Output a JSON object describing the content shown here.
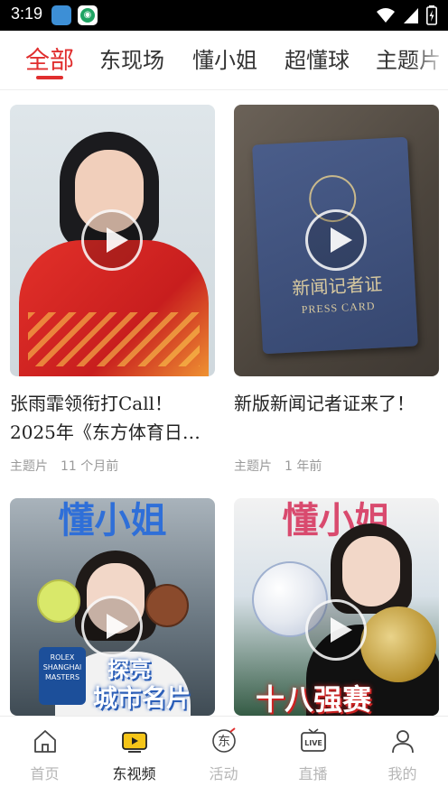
{
  "status_bar": {
    "time": "3:19",
    "icons": [
      "notification-app-icon",
      "app-icon",
      "wifi-icon",
      "signal-icon",
      "battery-icon"
    ]
  },
  "tabs": [
    {
      "label": "全部",
      "active": true
    },
    {
      "label": "东现场",
      "active": false
    },
    {
      "label": "懂小姐",
      "active": false
    },
    {
      "label": "超懂球",
      "active": false
    },
    {
      "label": "主题片",
      "active": false
    }
  ],
  "feed": [
    {
      "title": "张雨霏领衔打Call！2025年《东方体育日…",
      "tag": "主题片",
      "time": "11 个月前",
      "thumb_icon": "athlete-photo"
    },
    {
      "title": "新版新闻记者证来了！",
      "tag": "主题片",
      "time": "1 年前",
      "thumb_icon": "press-card-photo",
      "thumb_text": {
        "main": "新闻记者证",
        "sub": "PRESS CARD"
      }
    },
    {
      "title": "",
      "tag": "",
      "time": "",
      "thumb_icon": "host-photo",
      "thumb_text": {
        "banner": "懂小姐",
        "line1": "探亮",
        "line2": "城市名片",
        "badge": "ROLEX SHANGHAI MASTERS"
      }
    },
    {
      "title": "",
      "tag": "",
      "time": "",
      "thumb_icon": "host-photo",
      "thumb_text": {
        "banner": "懂小姐",
        "line1": "十八强赛"
      }
    }
  ],
  "bottom_nav": [
    {
      "label": "首页",
      "icon": "home-icon",
      "active": false
    },
    {
      "label": "东视频",
      "icon": "video-icon",
      "active": true
    },
    {
      "label": "活动",
      "icon": "dong-activity-icon",
      "active": false
    },
    {
      "label": "直播",
      "icon": "live-icon",
      "active": false
    },
    {
      "label": "我的",
      "icon": "profile-icon",
      "active": false
    }
  ],
  "colors": {
    "accent": "#e02e2e",
    "nav_active_icon": "#f5c518",
    "text_secondary": "#9a9a9a"
  }
}
